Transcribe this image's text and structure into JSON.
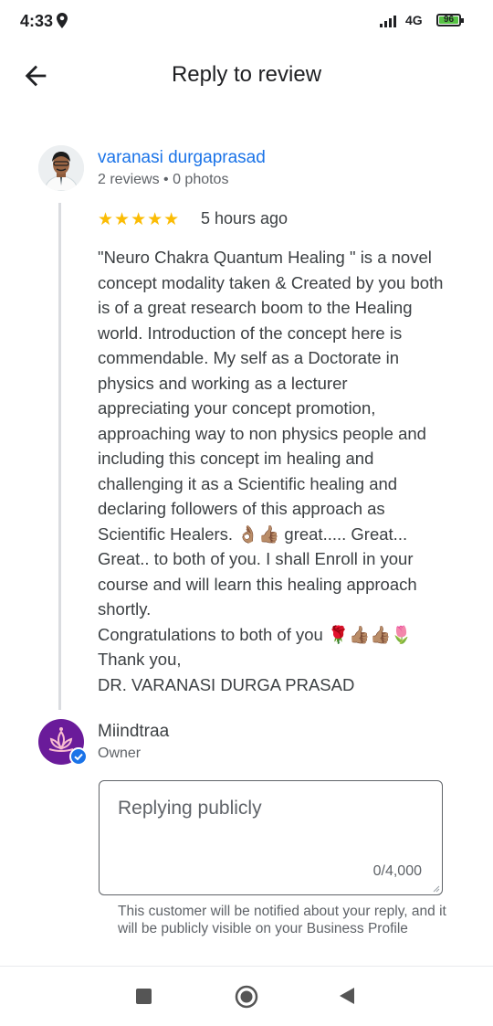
{
  "status_bar": {
    "time": "4:33",
    "network": "4G",
    "battery": "96"
  },
  "header": {
    "title": "Reply to review"
  },
  "review": {
    "reviewer_name": "varanasi durgaprasad",
    "reviewer_meta": "2 reviews • 0 photos",
    "rating": 5,
    "stars": "★★★★★",
    "time_ago": "5 hours ago",
    "lines": [
      "\"Neuro Chakra Quantum Healing \" is a novel",
      "concept modality taken & Created by you both",
      "is of a great research boom to the Healing",
      "world. Introduction of the concept here is",
      "commendable. My self as a Doctorate in",
      "physics and working as a lecturer",
      "appreciating your concept promotion,",
      "approaching way to non physics people and",
      "including this concept im healing and",
      "challenging it as a Scientific healing and",
      "declaring followers of this approach as",
      "Scientific Healers. 👌🏽👍🏽 great..... Great...",
      "Great.. to both of you. I shall Enroll in your",
      "course and will learn this healing approach",
      "shortly.",
      "Congratulations to both of you 🌹👍🏽👍🏽🌷",
      "Thank you,",
      "DR. VARANASI DURGA PRASAD"
    ]
  },
  "owner": {
    "name": "Miindtraa",
    "role": "Owner"
  },
  "reply": {
    "placeholder": "Replying publicly",
    "value": "",
    "counter": "0/4,000",
    "helper": "This customer will be notified about your reply, and it will be publicly visible on your Business Profile"
  },
  "colors": {
    "link_blue": "#1a73e8",
    "star_yellow": "#fbbc04",
    "owner_purple": "#6a1b9a",
    "battery_green": "#56c244"
  },
  "icons": {
    "back": "arrow-left-icon",
    "location": "location-pin-icon",
    "verified": "verified-check-icon",
    "nav_recents": "square-icon",
    "nav_home": "circle-icon",
    "nav_back": "triangle-back-icon"
  }
}
